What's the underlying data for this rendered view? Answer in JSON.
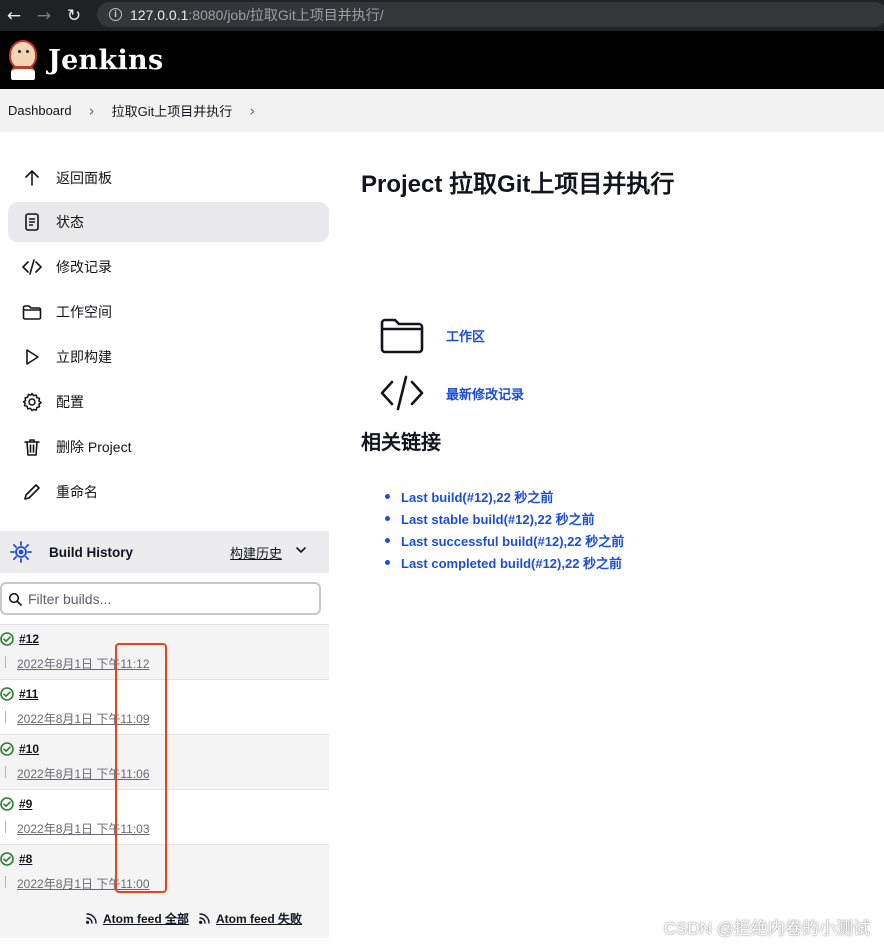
{
  "browser": {
    "url_host": "127.0.0.1",
    "url_rest": ":8080/job/拉取Git上项目并执行/"
  },
  "header": {
    "brand": "Jenkins"
  },
  "breadcrumb": [
    "Dashboard",
    "拉取Git上项目并执行"
  ],
  "sidebar": {
    "items": [
      {
        "label": "返回面板",
        "icon": "arrow-up-icon"
      },
      {
        "label": "状态",
        "icon": "document-icon",
        "active": true
      },
      {
        "label": "修改记录",
        "icon": "code-icon"
      },
      {
        "label": "工作空间",
        "icon": "folder-icon"
      },
      {
        "label": "立即构建",
        "icon": "play-icon"
      },
      {
        "label": "配置",
        "icon": "gear-icon"
      },
      {
        "label": "删除 Project",
        "icon": "trash-icon"
      },
      {
        "label": "重命名",
        "icon": "pencil-icon"
      }
    ]
  },
  "build_history": {
    "title": "Build History",
    "trend": "构建历史",
    "filter_placeholder": "Filter builds...",
    "builds": [
      {
        "number": "#12",
        "time": "2022年8月1日 下午11:12",
        "status": "success"
      },
      {
        "number": "#11",
        "time": "2022年8月1日 下午11:09",
        "status": "success"
      },
      {
        "number": "#10",
        "time": "2022年8月1日 下午11:06",
        "status": "success"
      },
      {
        "number": "#9",
        "time": "2022年8月1日 下午11:03",
        "status": "success"
      },
      {
        "number": "#8",
        "time": "2022年8月1日 下午11:00",
        "status": "success"
      }
    ],
    "feeds": [
      "Atom feed 全部",
      "Atom feed 失败"
    ]
  },
  "main": {
    "title": "Project 拉取Git上项目并执行",
    "links": [
      {
        "label": "工作区",
        "icon": "folder-icon"
      },
      {
        "label": "最新修改记录",
        "icon": "code-icon"
      }
    ],
    "related_title": "相关链接",
    "related": [
      "Last build(#12),22 秒之前",
      "Last stable build(#12),22 秒之前",
      "Last successful build(#12),22 秒之前",
      "Last completed build(#12),22 秒之前"
    ]
  },
  "watermark": "CSDN @拒绝内卷的小测试",
  "colors": {
    "link": "#1d4ed8",
    "highlight": "#e8431f",
    "success": "#2e7d32"
  }
}
